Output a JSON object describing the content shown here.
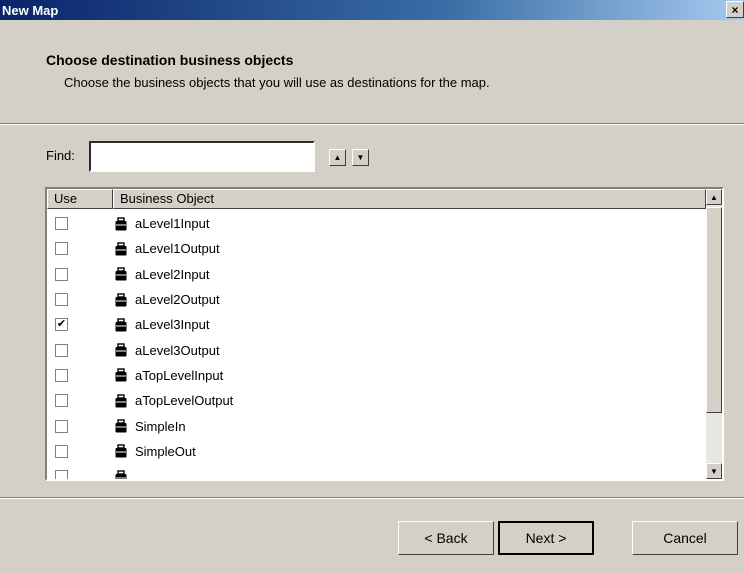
{
  "window": {
    "title": "New Map",
    "close_glyph": "×"
  },
  "header": {
    "title": "Choose destination business objects",
    "subtitle": "Choose the business objects that you will use as destinations for the map."
  },
  "find": {
    "label": "Find:",
    "value": "",
    "placeholder": ""
  },
  "list": {
    "columns": [
      "Use",
      "Business Object"
    ],
    "rows": [
      {
        "checked": false,
        "name": "aLevel1Input"
      },
      {
        "checked": false,
        "name": "aLevel1Output"
      },
      {
        "checked": false,
        "name": "aLevel2Input"
      },
      {
        "checked": false,
        "name": "aLevel2Output"
      },
      {
        "checked": true,
        "name": "aLevel3Input"
      },
      {
        "checked": false,
        "name": "aLevel3Output"
      },
      {
        "checked": false,
        "name": "aTopLevelInput"
      },
      {
        "checked": false,
        "name": "aTopLevelOutput"
      },
      {
        "checked": false,
        "name": "SimpleIn"
      },
      {
        "checked": false,
        "name": "SimpleOut"
      },
      {
        "checked": false,
        "name": ""
      }
    ],
    "icon": "business-object-icon"
  },
  "buttons": {
    "back": "< Back",
    "next": "Next >",
    "cancel": "Cancel"
  }
}
